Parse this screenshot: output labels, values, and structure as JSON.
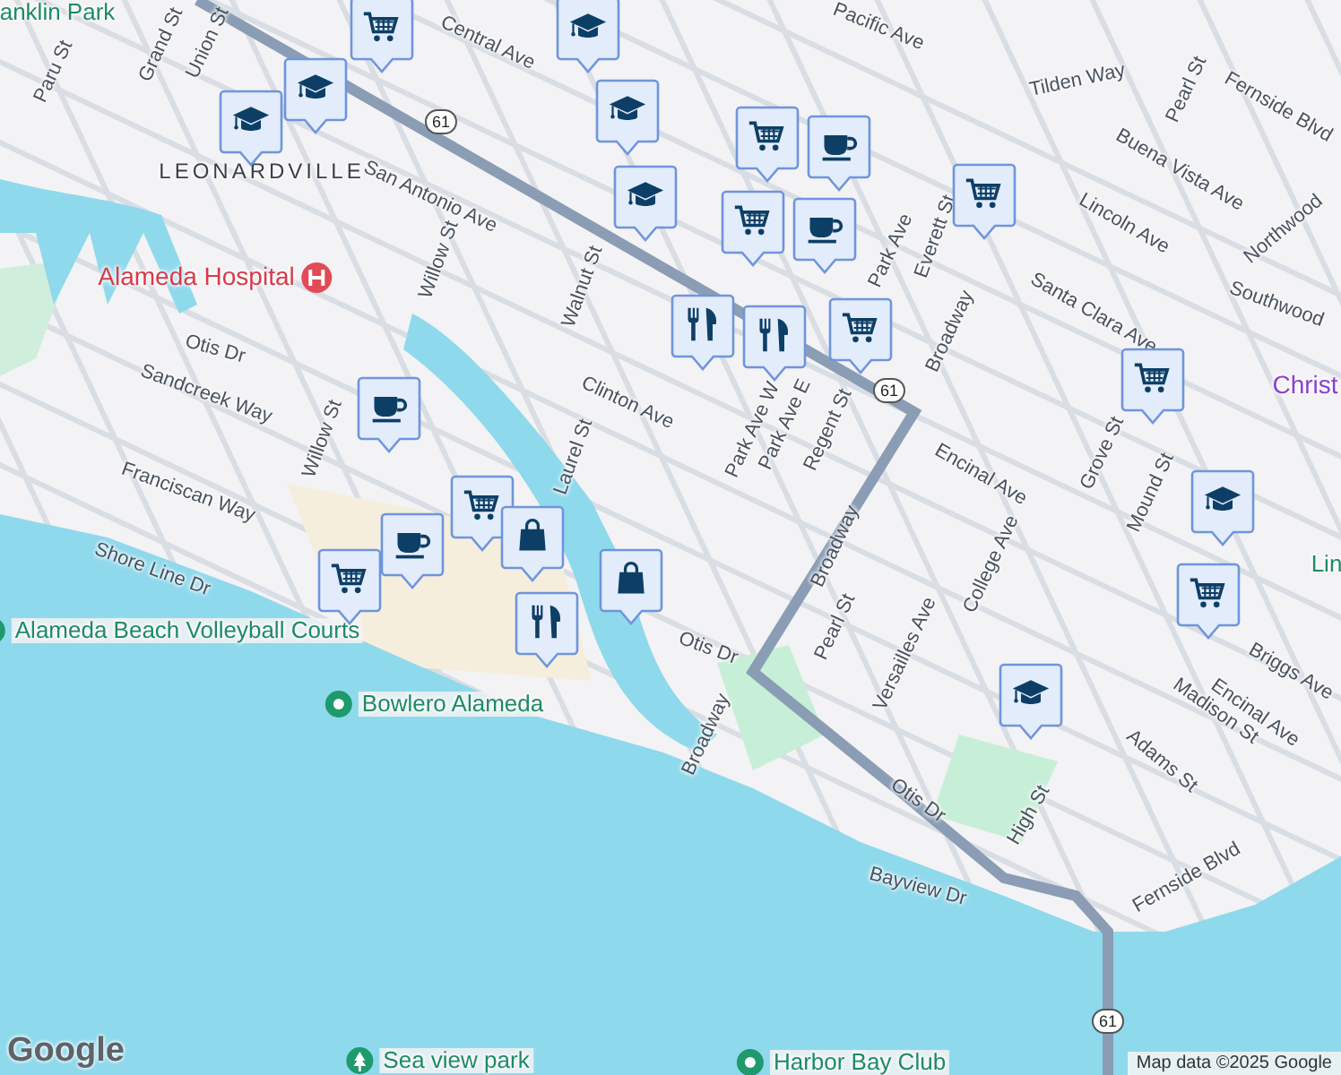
{
  "map": {
    "labels": [
      {
        "text": "anklin Park",
        "kind": "park-name"
      },
      {
        "text": "Paru St",
        "kind": "street"
      },
      {
        "text": "Grand St",
        "kind": "street"
      },
      {
        "text": "Union St",
        "kind": "street"
      },
      {
        "text": "Central Ave",
        "kind": "street"
      },
      {
        "text": "Pacific Ave",
        "kind": "street"
      },
      {
        "text": "Tilden Way",
        "kind": "street"
      },
      {
        "text": "Pearl St",
        "kind": "street"
      },
      {
        "text": "Fernside Blvd",
        "kind": "street"
      },
      {
        "text": "LEONARDVILLE",
        "kind": "district"
      },
      {
        "text": "San Antonio Ave",
        "kind": "street"
      },
      {
        "text": "Buena Vista Ave",
        "kind": "street"
      },
      {
        "text": "Everett St",
        "kind": "street"
      },
      {
        "text": "Lincoln Ave",
        "kind": "street"
      },
      {
        "text": "Northwood",
        "kind": "street"
      },
      {
        "text": "Alameda Hospital",
        "kind": "hospital"
      },
      {
        "text": "Willow St",
        "kind": "street"
      },
      {
        "text": "Walnut St",
        "kind": "street"
      },
      {
        "text": "Park Ave",
        "kind": "street"
      },
      {
        "text": "Southwood",
        "kind": "street"
      },
      {
        "text": "Santa Clara Ave",
        "kind": "street"
      },
      {
        "text": "Broadway",
        "kind": "street"
      },
      {
        "text": "Christ",
        "kind": "church"
      },
      {
        "text": "Otis Dr",
        "kind": "street"
      },
      {
        "text": "Sandcreek Way",
        "kind": "street"
      },
      {
        "text": "Clinton Ave",
        "kind": "street"
      },
      {
        "text": "Park Ave W",
        "kind": "street"
      },
      {
        "text": "Park Ave E",
        "kind": "street"
      },
      {
        "text": "Regent St",
        "kind": "street"
      },
      {
        "text": "Willow St",
        "kind": "street"
      },
      {
        "text": "Laurel St",
        "kind": "street"
      },
      {
        "text": "Encinal Ave",
        "kind": "street"
      },
      {
        "text": "Grove St",
        "kind": "street"
      },
      {
        "text": "Mound St",
        "kind": "street"
      },
      {
        "text": "Franciscan Way",
        "kind": "street"
      },
      {
        "text": "Broadway",
        "kind": "street"
      },
      {
        "text": "College Ave",
        "kind": "street"
      },
      {
        "text": "Lin",
        "kind": "park-name"
      },
      {
        "text": "Shore Line Dr",
        "kind": "street"
      },
      {
        "text": "Alameda Beach Volleyball Courts",
        "kind": "poi"
      },
      {
        "text": "Otis Dr",
        "kind": "street"
      },
      {
        "text": "Pearl St",
        "kind": "street"
      },
      {
        "text": "Versailles Ave",
        "kind": "street"
      },
      {
        "text": "Briggs Ave",
        "kind": "street"
      },
      {
        "text": "Encinal Ave",
        "kind": "street"
      },
      {
        "text": "Madison St",
        "kind": "street"
      },
      {
        "text": "Bowlero Alameda",
        "kind": "poi"
      },
      {
        "text": "Broadway",
        "kind": "street"
      },
      {
        "text": "Adams St",
        "kind": "street"
      },
      {
        "text": "Otis Dr",
        "kind": "street"
      },
      {
        "text": "High St",
        "kind": "street"
      },
      {
        "text": "Bayview Dr",
        "kind": "street"
      },
      {
        "text": "Fernside Blvd",
        "kind": "street"
      },
      {
        "text": "Sea view park",
        "kind": "park"
      },
      {
        "text": "Harbor Bay Club",
        "kind": "poi"
      }
    ],
    "route_shields": [
      "61",
      "61",
      "61"
    ],
    "markers": [
      {
        "kind": "cart"
      },
      {
        "kind": "cap"
      },
      {
        "kind": "cap"
      },
      {
        "kind": "cap"
      },
      {
        "kind": "cap"
      },
      {
        "kind": "cap"
      },
      {
        "kind": "cart"
      },
      {
        "kind": "cup"
      },
      {
        "kind": "cup"
      },
      {
        "kind": "cart"
      },
      {
        "kind": "cart"
      },
      {
        "kind": "cart"
      },
      {
        "kind": "fork"
      },
      {
        "kind": "fork"
      },
      {
        "kind": "cup"
      },
      {
        "kind": "cart"
      },
      {
        "kind": "cup"
      },
      {
        "kind": "bag"
      },
      {
        "kind": "fork"
      },
      {
        "kind": "cart"
      },
      {
        "kind": "bag"
      },
      {
        "kind": "cart"
      },
      {
        "kind": "cap"
      },
      {
        "kind": "cart"
      },
      {
        "kind": "cap"
      }
    ],
    "logo": "Google",
    "attribution": "Map data ©2025 Google"
  }
}
